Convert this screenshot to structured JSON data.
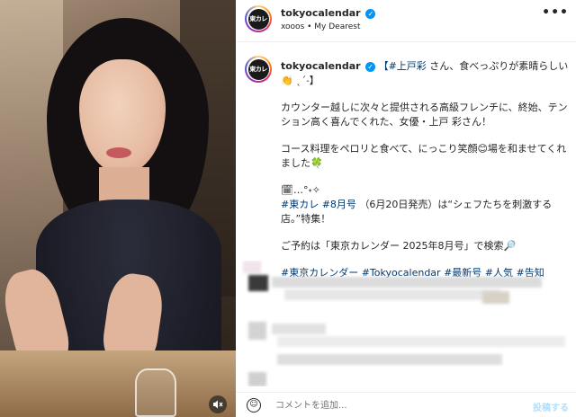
{
  "header": {
    "username": "tokyocalendar",
    "subtitle": "xooos • My Dearest",
    "avatar_text": "東カレ",
    "more_label": "•••"
  },
  "caption": {
    "username": "tokyocalendar",
    "line1_tag": "【#上戸彩",
    "line1_text": " さん、食べっぷりが素晴らしい",
    "line1_end": "👏 ˎˊ˗】",
    "para2": "カウンター越しに次々と提供される高級フレンチに、終始、テンション高く喜んでくれた、女優・上戸 彩さん！",
    "para3": "コース料理をペロリと食べて、にっこり笑顔😊場を和ませてくれました🍀",
    "para4_line1": "🗓…°˖✧",
    "tag_higashikare": "#東カレ",
    "tag_issue": "#8月号",
    "para4_rest": "（6月20日発売）は“シェフたちを刺激する店。”特集！",
    "para5": "ご予約は「東京カレンダー 2025年8月号」で検索🔎",
    "hashtags": [
      "#東京カレンダー",
      "#Tokyocalendar",
      "#最新号",
      "#人気",
      "#告知"
    ]
  },
  "comment_bar": {
    "emoji_icon": "smiley-icon",
    "placeholder": "コメントを追加...",
    "post_label": "投稿する"
  },
  "media": {
    "mute_icon": "speaker-muted-icon"
  },
  "colors": {
    "link": "#00376b",
    "verified": "#0095f6",
    "post_disabled": "#b2dffc"
  }
}
